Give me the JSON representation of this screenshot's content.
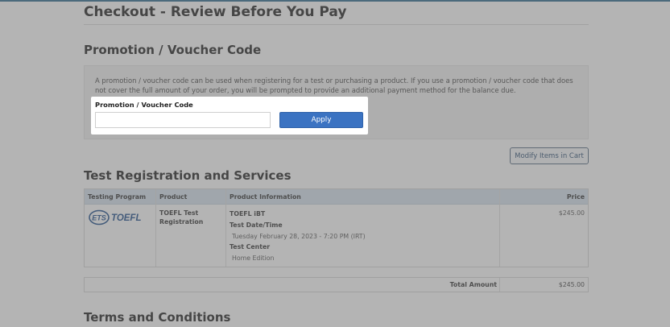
{
  "page": {
    "title": "Checkout - Review Before You Pay"
  },
  "promotion": {
    "heading": "Promotion / Voucher Code",
    "description": "A promotion / voucher code can be used when registering for a test or purchasing a product. If you use a promotion / voucher code that does not cover the full amount of your order, you will be prompted to provide an additional payment method for the balance due.",
    "field_label": "Promotion / Voucher Code",
    "input_value": "",
    "input_placeholder": "",
    "apply_label": "Apply"
  },
  "cart": {
    "modify_label": "Modify Items in Cart"
  },
  "registration": {
    "heading": "Test Registration and Services",
    "columns": [
      "Testing Program",
      "Product",
      "Product Information",
      "Price"
    ],
    "row": {
      "logo": {
        "ets": "ETS",
        "toefl": "TOEFL",
        "icon": "ets-toefl-logo",
        "color": "#1f4e8c"
      },
      "product_line1": "TOEFL Test",
      "product_line2": "Registration",
      "info_title": "TOEFL iBT",
      "date_label": "Test Date/Time",
      "date_value": "Tuesday February 28, 2023 - 7:20 PM (IRT)",
      "center_label": "Test Center",
      "center_value": "Home Edition",
      "price": "$245.00"
    },
    "total_label": "Total Amount",
    "total_value": "$245.00"
  },
  "terms": {
    "heading": "Terms and Conditions"
  },
  "colors": {
    "accent": "#3b73c2",
    "table_header": "#d6e3ef",
    "overlay": "rgba(105,105,105,0.5)"
  }
}
